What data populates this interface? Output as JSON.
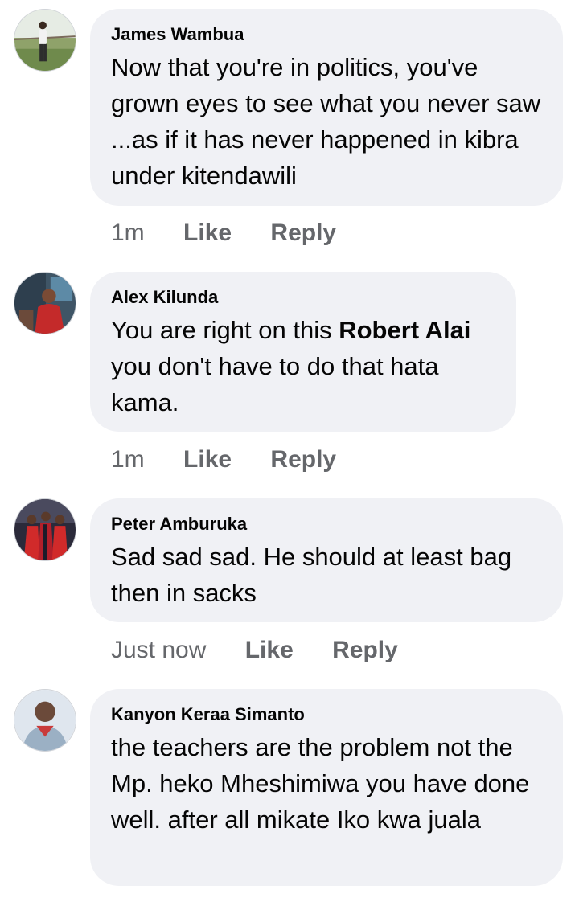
{
  "comments": [
    {
      "author": "James Wambua",
      "text": "Now that you're in politics, you've grown eyes to see what you never saw ...as if it has never happened in kibra under kitendawili",
      "time": "1m",
      "like_label": "Like",
      "reply_label": "Reply",
      "avatar_icon": "person-standing-photo"
    },
    {
      "author": "Alex Kilunda",
      "text_before": "You are right on this ",
      "mention": "Robert Alai",
      "text_after": " you don't have to do that hata kama.",
      "time": "1m",
      "like_label": "Like",
      "reply_label": "Reply",
      "avatar_icon": "person-red-shirt-photo"
    },
    {
      "author": "Peter Amburuka",
      "text": "Sad sad sad. He should at least bag then in sacks",
      "time": "Just now",
      "like_label": "Like",
      "reply_label": "Reply",
      "avatar_icon": "group-red-robes-photo"
    },
    {
      "author": "Kanyon Keraa Simanto",
      "text": "the teachers are the problem not the Mp. heko Mheshimiwa you have done well. after all mikate Iko kwa juala",
      "avatar_icon": "person-portrait-photo"
    }
  ],
  "colors": {
    "bubble": "#f0f1f5",
    "text": "#050505",
    "meta": "#65676b"
  }
}
